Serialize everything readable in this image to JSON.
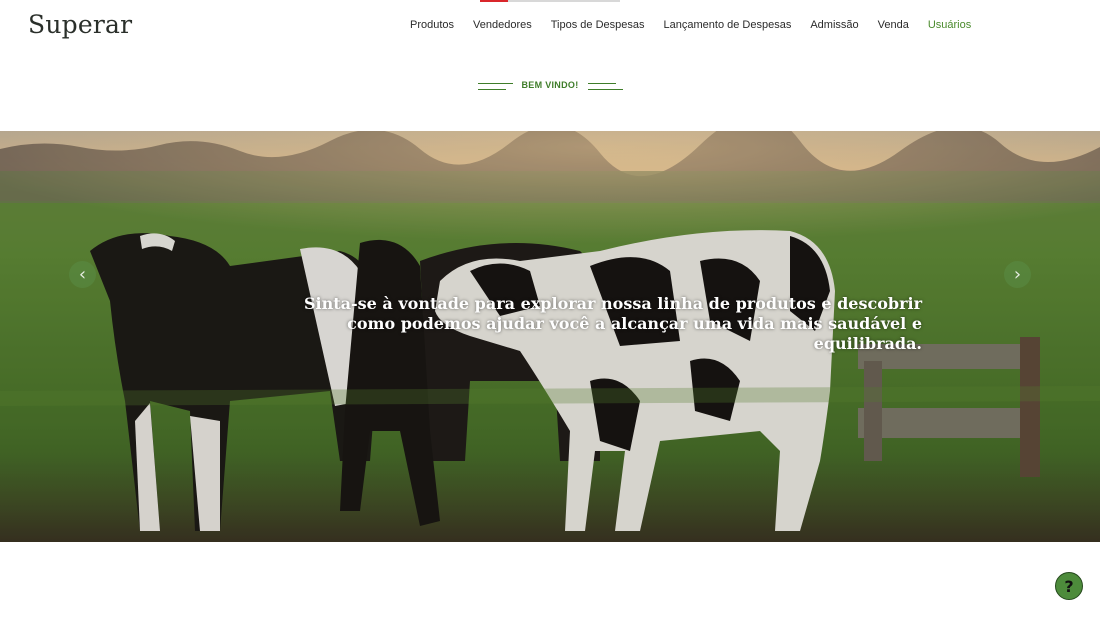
{
  "header": {
    "brand": "Superar",
    "nav": [
      {
        "label": "Produtos",
        "active": false
      },
      {
        "label": "Vendedores",
        "active": false
      },
      {
        "label": "Tipos de Despesas",
        "active": false
      },
      {
        "label": "Lançamento de Despesas",
        "active": false
      },
      {
        "label": "Admissão",
        "active": false
      },
      {
        "label": "Venda",
        "active": false
      },
      {
        "label": "Usuários",
        "active": true
      }
    ]
  },
  "welcome": {
    "text": "BEM VINDO!"
  },
  "hero": {
    "caption": "Sinta-se à vontade para explorar nossa linha de produtos e descobrir como podemos ajudar você a alcançar uma vida mais saudável e equilibrada.",
    "prev_icon": "chevron-left-icon",
    "next_icon": "chevron-right-icon"
  },
  "help": {
    "label": "?",
    "icon": "question-icon"
  },
  "colors": {
    "accent": "#4a8a2c",
    "help_bg": "#4d8b3b",
    "top_accent_red": "#d9262b"
  }
}
